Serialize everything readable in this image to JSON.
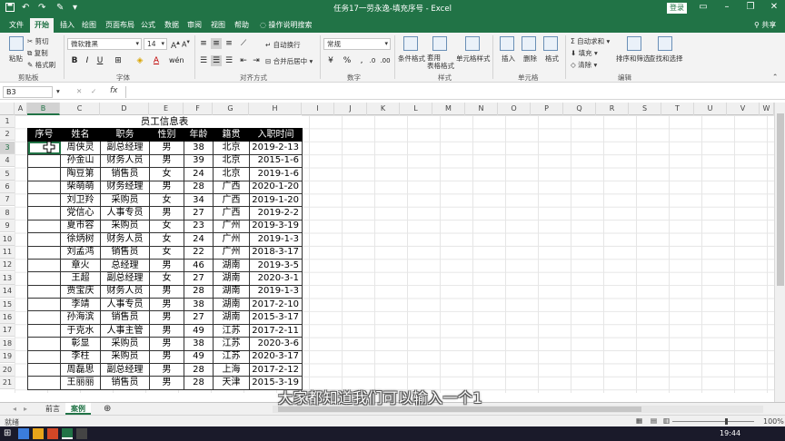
{
  "titlebar": {
    "title": "任务17一劳永逸-填充序号 - Excel",
    "login_label": "登录",
    "qa_icons": [
      "save-icon",
      "undo-icon",
      "redo-icon",
      "brush-icon",
      "more-icon"
    ]
  },
  "ribbon_tabs": [
    "文件",
    "开始",
    "插入",
    "绘图",
    "页面布局",
    "公式",
    "数据",
    "审阅",
    "视图",
    "帮助"
  ],
  "active_tab": "开始",
  "tell_me": "操作说明搜索",
  "share_label": "共享",
  "ribbon": {
    "clipboard": {
      "paste": "粘贴",
      "cut": "剪切",
      "copy": "复制",
      "format_painter": "格式刷",
      "label": "剪贴板"
    },
    "font": {
      "name": "微软雅黑",
      "size": "14",
      "label": "字体"
    },
    "alignment": {
      "wrap": "自动换行",
      "merge": "合并后居中",
      "label": "对齐方式"
    },
    "number": {
      "format": "常规",
      "percent": "%",
      "comma": ",",
      "label": "数字"
    },
    "styles": {
      "conditional": "条件格式",
      "table": "套用\n表格格式",
      "cell_styles": "单元格样式",
      "label": "样式"
    },
    "cells": {
      "insert": "插入",
      "delete": "删除",
      "format": "格式",
      "label": "单元格"
    },
    "editing": {
      "autosum": "自动求和",
      "fill": "填充",
      "clear": "清除",
      "sort": "排序和筛选",
      "find": "查找和选择",
      "label": "编辑"
    }
  },
  "formula_bar": {
    "name_box": "B3",
    "fx": "fx",
    "value": ""
  },
  "columns": [
    "A",
    "B",
    "C",
    "D",
    "E",
    "F",
    "G",
    "H",
    "I",
    "J",
    "K",
    "L",
    "M",
    "N",
    "O",
    "P",
    "Q",
    "R",
    "S",
    "T",
    "U",
    "V",
    "W"
  ],
  "rows": [
    "1",
    "2",
    "3",
    "4",
    "5",
    "6",
    "7",
    "8",
    "9",
    "10",
    "11",
    "12",
    "13",
    "14",
    "15",
    "16",
    "17",
    "18",
    "19",
    "20",
    "21"
  ],
  "selected_cell": "B3",
  "sheet_title": "员工信息表",
  "table": {
    "headers": [
      "序号",
      "姓名",
      "职务",
      "性别",
      "年龄",
      "籍贯",
      "入职时间"
    ],
    "rows": [
      [
        "",
        "周侠灵",
        "副总经理",
        "男",
        "38",
        "北京",
        "2019-2-13"
      ],
      [
        "",
        "孙金山",
        "财务人员",
        "男",
        "39",
        "北京",
        "2015-1-6"
      ],
      [
        "",
        "陶豆第",
        "销售员",
        "女",
        "24",
        "北京",
        "2019-1-6"
      ],
      [
        "",
        "柴萌萌",
        "财务经理",
        "男",
        "28",
        "广西",
        "2020-1-20"
      ],
      [
        "",
        "刘卫羚",
        "采购员",
        "女",
        "34",
        "广西",
        "2019-1-20"
      ],
      [
        "",
        "党信心",
        "人事专员",
        "男",
        "27",
        "广西",
        "2019-2-2"
      ],
      [
        "",
        "夏市容",
        "采购员",
        "女",
        "23",
        "广州",
        "2019-3-19"
      ],
      [
        "",
        "徐炳树",
        "财务人员",
        "女",
        "24",
        "广州",
        "2019-1-3"
      ],
      [
        "",
        "刘孟鸿",
        "销售员",
        "女",
        "22",
        "广州",
        "2018-3-17"
      ],
      [
        "",
        "章火",
        "总经理",
        "男",
        "46",
        "湖南",
        "2019-3-5"
      ],
      [
        "",
        "王超",
        "副总经理",
        "女",
        "27",
        "湖南",
        "2020-3-1"
      ],
      [
        "",
        "贾宝庆",
        "财务人员",
        "男",
        "28",
        "湖南",
        "2019-1-3"
      ],
      [
        "",
        "李靖",
        "人事专员",
        "男",
        "38",
        "湖南",
        "2017-2-10"
      ],
      [
        "",
        "孙海滨",
        "销售员",
        "男",
        "27",
        "湖南",
        "2015-3-17"
      ],
      [
        "",
        "于克水",
        "人事主管",
        "男",
        "49",
        "江苏",
        "2017-2-11"
      ],
      [
        "",
        "彰显",
        "采购员",
        "男",
        "38",
        "江苏",
        "2020-3-6"
      ],
      [
        "",
        "李柱",
        "采购员",
        "男",
        "49",
        "江苏",
        "2020-3-17"
      ],
      [
        "",
        "周磊思",
        "副总经理",
        "男",
        "28",
        "上海",
        "2017-2-12"
      ],
      [
        "",
        "王丽丽",
        "销售员",
        "男",
        "28",
        "天津",
        "2015-3-19"
      ]
    ]
  },
  "sheet_tabs": [
    "前言",
    "案例"
  ],
  "active_sheet": "案例",
  "status": {
    "text": "就绪",
    "zoom": "100%"
  },
  "taskbar": {
    "time": "19:44"
  },
  "subtitle": "大家都知道我们可以输入一个1",
  "colors": {
    "excel_green": "#217346",
    "header_black": "#000000",
    "ribbon_gray": "#f3f3f3"
  }
}
